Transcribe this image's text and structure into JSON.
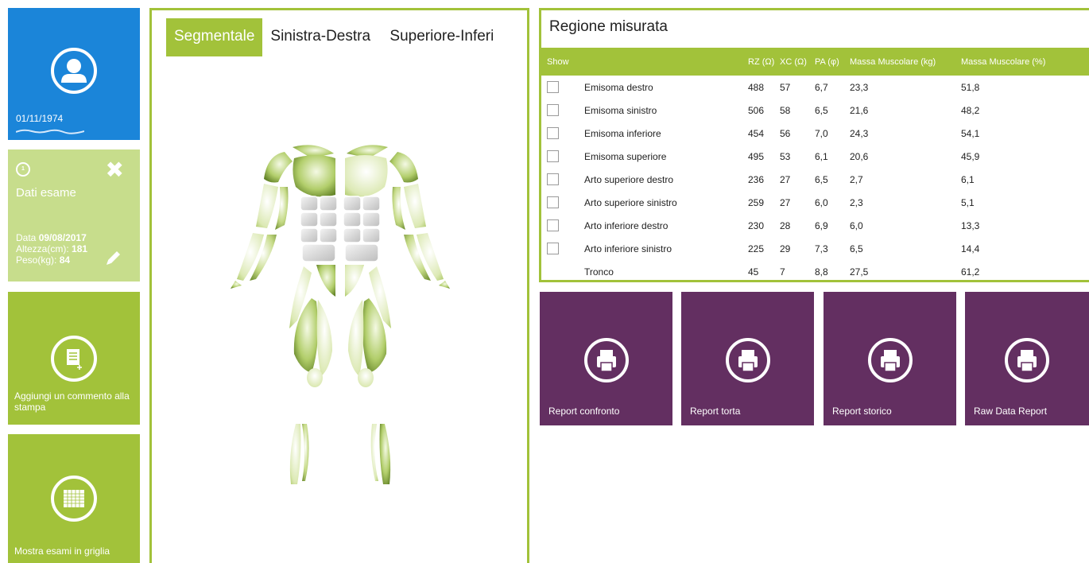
{
  "patient": {
    "dob": "01/11/1974",
    "icon": "user-icon"
  },
  "exam": {
    "index": "1",
    "title": "Dati esame",
    "date_label": "Data",
    "date_value": "09/08/2017",
    "height_label": "Altezza(cm):",
    "height_value": "181",
    "weight_label": "Peso(kg):",
    "weight_value": "84"
  },
  "actions": {
    "comment_label": "Aggiungi un commento alla stampa",
    "grid_label": "Mostra esami in griglia"
  },
  "body_view": {
    "tabs": [
      {
        "label": "Segmentale",
        "active": true
      },
      {
        "label": "Sinistra-Destra",
        "active": false
      },
      {
        "label": "Superiore-Inferiore",
        "active": false
      }
    ]
  },
  "region": {
    "title": "Regione misurata",
    "headers": [
      "Show",
      "RZ (Ω)",
      "XC (Ω)",
      "PA (φ)",
      "Massa Muscolare (kg)",
      "Massa Muscolare (%)"
    ],
    "rows": [
      {
        "name": "Emisoma destro",
        "rz": "488",
        "xc": "57",
        "pa": "6,7",
        "mkg": "23,3",
        "mpct": "51,8",
        "has_checkbox": true
      },
      {
        "name": "Emisoma sinistro",
        "rz": "506",
        "xc": "58",
        "pa": "6,5",
        "mkg": "21,6",
        "mpct": "48,2",
        "has_checkbox": true
      },
      {
        "name": "Emisoma inferiore",
        "rz": "454",
        "xc": "56",
        "pa": "7,0",
        "mkg": "24,3",
        "mpct": "54,1",
        "has_checkbox": true
      },
      {
        "name": "Emisoma superiore",
        "rz": "495",
        "xc": "53",
        "pa": "6,1",
        "mkg": "20,6",
        "mpct": "45,9",
        "has_checkbox": true
      },
      {
        "name": "Arto superiore destro",
        "rz": "236",
        "xc": "27",
        "pa": "6,5",
        "mkg": "2,7",
        "mpct": "6,1",
        "has_checkbox": true
      },
      {
        "name": "Arto superiore sinistro",
        "rz": "259",
        "xc": "27",
        "pa": "6,0",
        "mkg": "2,3",
        "mpct": "5,1",
        "has_checkbox": true
      },
      {
        "name": "Arto inferiore destro",
        "rz": "230",
        "xc": "28",
        "pa": "6,9",
        "mkg": "6,0",
        "mpct": "13,3",
        "has_checkbox": true
      },
      {
        "name": "Arto inferiore sinistro",
        "rz": "225",
        "xc": "29",
        "pa": "7,3",
        "mkg": "6,5",
        "mpct": "14,4",
        "has_checkbox": true
      },
      {
        "name": "Tronco",
        "rz": "45",
        "xc": "7",
        "pa": "8,8",
        "mkg": "27,5",
        "mpct": "61,2",
        "has_checkbox": false
      }
    ]
  },
  "reports": [
    {
      "label": "Report confronto"
    },
    {
      "label": "Report torta"
    },
    {
      "label": "Report storico"
    },
    {
      "label": "Raw Data Report"
    }
  ],
  "colors": {
    "blue": "#1b85d9",
    "green": "#a2c23a",
    "light_green": "#c7dd8c",
    "purple": "#632f61"
  }
}
